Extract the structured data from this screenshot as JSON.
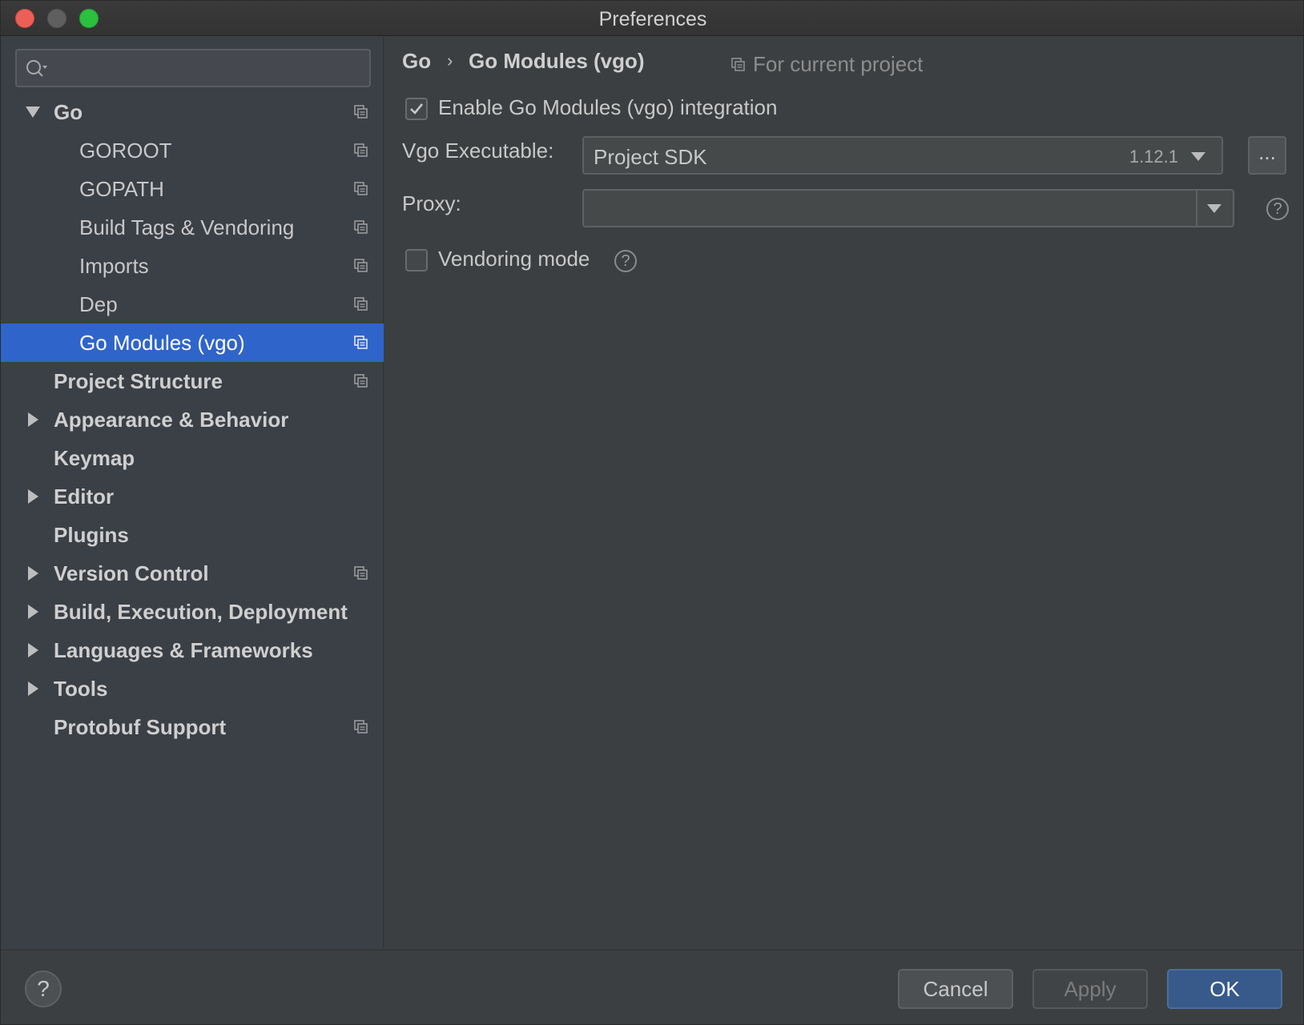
{
  "window": {
    "title": "Preferences"
  },
  "search": {
    "placeholder": "",
    "value": ""
  },
  "sidebar": {
    "items": [
      {
        "label": "Go",
        "bold": true,
        "arrow": "down",
        "level": 0,
        "has_project_icon": true
      },
      {
        "label": "GOROOT",
        "bold": false,
        "arrow": "none",
        "level": 1,
        "has_project_icon": true
      },
      {
        "label": "GOPATH",
        "bold": false,
        "arrow": "none",
        "level": 1,
        "has_project_icon": true
      },
      {
        "label": "Build Tags & Vendoring",
        "bold": false,
        "arrow": "none",
        "level": 1,
        "has_project_icon": true
      },
      {
        "label": "Imports",
        "bold": false,
        "arrow": "none",
        "level": 1,
        "has_project_icon": true
      },
      {
        "label": "Dep",
        "bold": false,
        "arrow": "none",
        "level": 1,
        "has_project_icon": true
      },
      {
        "label": "Go Modules (vgo)",
        "bold": false,
        "arrow": "none",
        "level": 1,
        "has_project_icon": true,
        "selected": true
      },
      {
        "label": "Project Structure",
        "bold": true,
        "arrow": "none",
        "level": 0,
        "has_project_icon": true
      },
      {
        "label": "Appearance & Behavior",
        "bold": true,
        "arrow": "right",
        "level": 0,
        "has_project_icon": false
      },
      {
        "label": "Keymap",
        "bold": true,
        "arrow": "none",
        "level": 0,
        "has_project_icon": false
      },
      {
        "label": "Editor",
        "bold": true,
        "arrow": "right",
        "level": 0,
        "has_project_icon": false
      },
      {
        "label": "Plugins",
        "bold": true,
        "arrow": "none",
        "level": 0,
        "has_project_icon": false
      },
      {
        "label": "Version Control",
        "bold": true,
        "arrow": "right",
        "level": 0,
        "has_project_icon": true
      },
      {
        "label": "Build, Execution, Deployment",
        "bold": true,
        "arrow": "right",
        "level": 0,
        "has_project_icon": false
      },
      {
        "label": "Languages & Frameworks",
        "bold": true,
        "arrow": "right",
        "level": 0,
        "has_project_icon": false
      },
      {
        "label": "Tools",
        "bold": true,
        "arrow": "right",
        "level": 0,
        "has_project_icon": false
      },
      {
        "label": "Protobuf Support",
        "bold": true,
        "arrow": "none",
        "level": 0,
        "has_project_icon": true
      }
    ]
  },
  "breadcrumb": {
    "parent": "Go",
    "separator": "›",
    "current": "Go Modules (vgo)",
    "scope": "For current project"
  },
  "settings": {
    "enable_vgo": {
      "label": "Enable Go Modules (vgo) integration",
      "checked": true
    },
    "vgo_executable": {
      "label": "Vgo Executable:",
      "value": "Project SDK",
      "version": "1.12.1",
      "browse_label": "..."
    },
    "proxy": {
      "label": "Proxy:",
      "value": ""
    },
    "vendoring": {
      "label": "Vendoring mode",
      "checked": false
    }
  },
  "footer": {
    "help_label": "?",
    "cancel_label": "Cancel",
    "apply_label": "Apply",
    "ok_label": "OK"
  },
  "colors": {
    "accent": "#2f65ca",
    "primary_button": "#375a8b",
    "close": "#ec5f57",
    "maximize": "#2bc13f"
  }
}
